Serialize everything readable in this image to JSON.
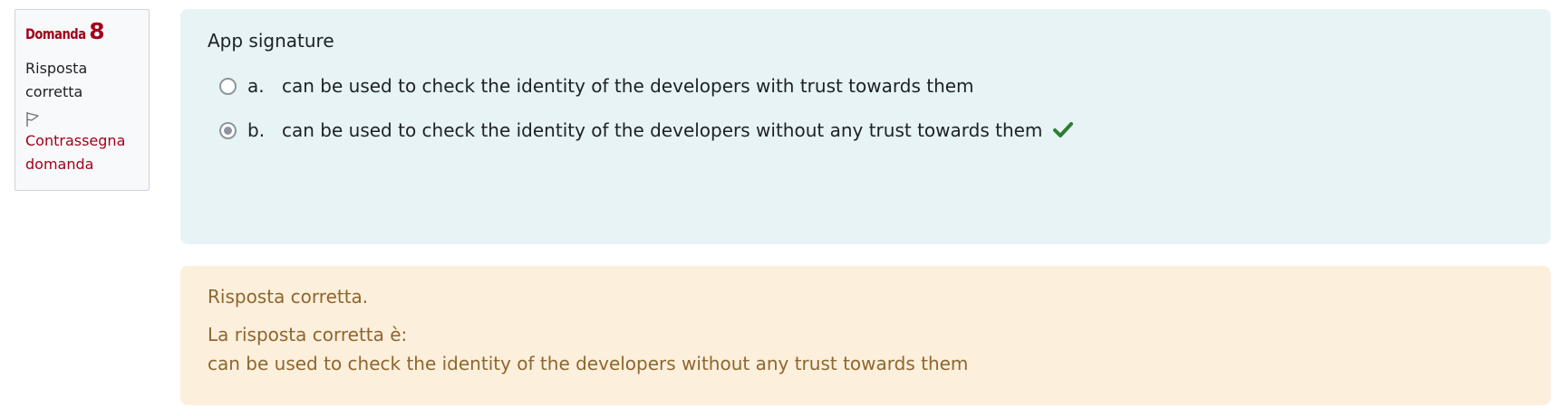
{
  "info": {
    "question_word": "Domanda",
    "question_number": "8",
    "state": "Risposta corretta",
    "flag_label": "Contrassegna domanda"
  },
  "question": {
    "text": "App signature",
    "answers": [
      {
        "num": "a.",
        "text": "can be used to check the identity of the developers with trust towards them",
        "selected": false
      },
      {
        "num": "b.",
        "text": "can be used to check the identity of the developers without any trust towards them",
        "selected": true,
        "correct": true
      }
    ]
  },
  "outcome": {
    "feedback": "Risposta corretta.",
    "rightanswer_label": "La risposta corretta è:",
    "rightanswer_text": "can be used to check the identity of the developers without any trust towards them"
  },
  "colors": {
    "accent": "#a3001b",
    "formulation_bg": "#e7f3f5",
    "outcome_bg": "#fcefdc",
    "outcome_text": "#8e662e",
    "correct_tick": "#2e7d32"
  },
  "icons": {
    "flag": "flag-icon",
    "correct": "checkmark-icon"
  }
}
